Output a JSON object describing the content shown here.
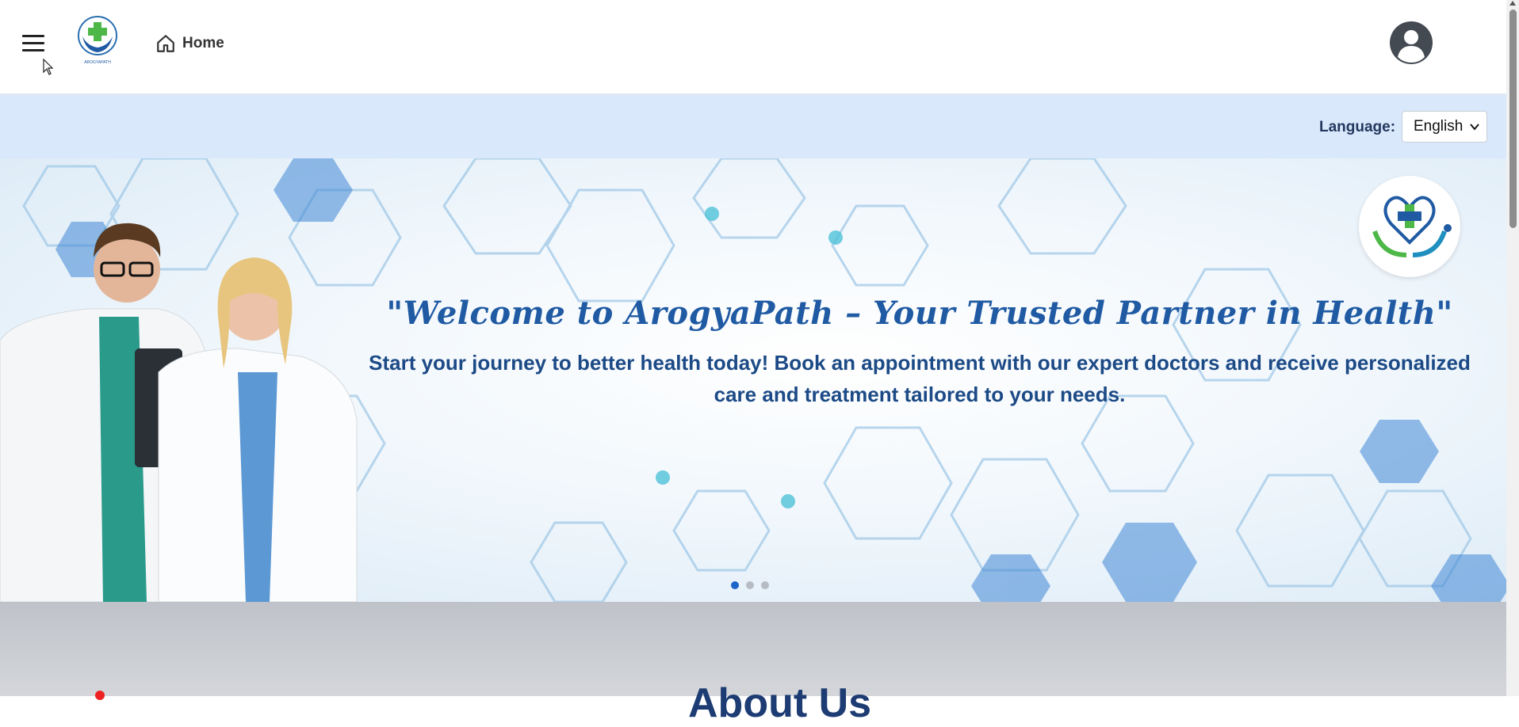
{
  "app": {
    "name": "ArogyaPath",
    "logo_text": "AROGYAPATH"
  },
  "topbar": {
    "home_label": "Home"
  },
  "language": {
    "label": "Language:",
    "selected": "English"
  },
  "banner": {
    "title": "\"Welcome to ArogyaPath – Your Trusted Partner in Health\"",
    "subtitle": "Start your journey to better health today! Book an appointment with our expert doctors and receive personalized care and treatment tailored to your needs.",
    "slide_count": 3,
    "active_slide": 1
  },
  "section": {
    "about_title": "About Us"
  },
  "colors": {
    "accent": "#1f5aa3",
    "lang_bar": "#d9e8fa",
    "active_dot": "#1d66c9"
  }
}
